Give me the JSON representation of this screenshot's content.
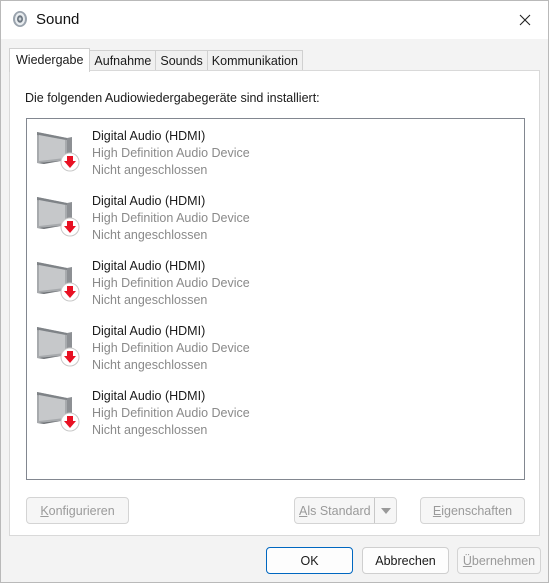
{
  "window": {
    "title": "Sound"
  },
  "tabs": [
    {
      "label": "Wiedergabe",
      "active": true
    },
    {
      "label": "Aufnahme",
      "active": false
    },
    {
      "label": "Sounds",
      "active": false
    },
    {
      "label": "Kommunikation",
      "active": false
    }
  ],
  "panel": {
    "intro": "Die folgenden Audiowiedergabegeräte sind installiert:"
  },
  "devices": [
    {
      "name": "Digital Audio (HDMI)",
      "driver": "High Definition Audio Device",
      "status": "Nicht angeschlossen",
      "icon": "speaker-disconnected-icon"
    },
    {
      "name": "Digital Audio (HDMI)",
      "driver": "High Definition Audio Device",
      "status": "Nicht angeschlossen",
      "icon": "speaker-disconnected-icon"
    },
    {
      "name": "Digital Audio (HDMI)",
      "driver": "High Definition Audio Device",
      "status": "Nicht angeschlossen",
      "icon": "speaker-disconnected-icon"
    },
    {
      "name": "Digital Audio (HDMI)",
      "driver": "High Definition Audio Device",
      "status": "Nicht angeschlossen",
      "icon": "speaker-disconnected-icon"
    },
    {
      "name": "Digital Audio (HDMI)",
      "driver": "High Definition Audio Device",
      "status": "Nicht angeschlossen",
      "icon": "speaker-disconnected-icon"
    }
  ],
  "panel_buttons": {
    "configure": {
      "mnemonic": "K",
      "rest": "onfigurieren"
    },
    "set_default": {
      "mnemonic": "A",
      "rest": "ls Standard"
    },
    "properties": {
      "mnemonic": "E",
      "rest": "igenschaften"
    }
  },
  "dialog_buttons": {
    "ok": "OK",
    "cancel": "Abbrechen",
    "apply": {
      "mnemonic": "Ü",
      "rest": "bernehmen"
    }
  },
  "colors": {
    "accent": "#0067c0",
    "status_arrow": "#e81123",
    "disabled_text": "#9a9a9a",
    "secondary_text": "#8a8a8a"
  }
}
